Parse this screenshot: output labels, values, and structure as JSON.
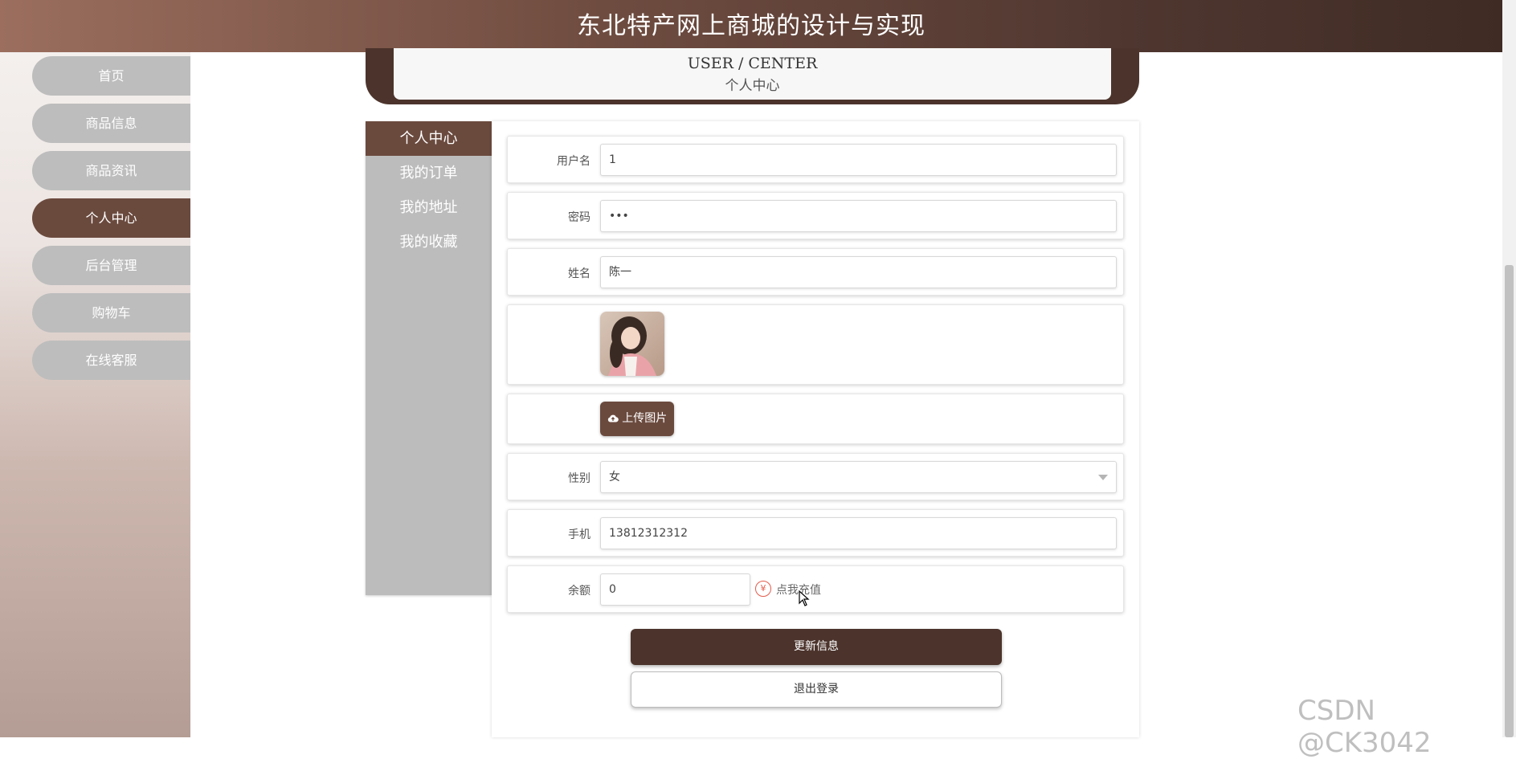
{
  "header": {
    "title": "东北特产网上商城的设计与实现"
  },
  "sidebar": {
    "items": [
      {
        "label": "首页",
        "active": false
      },
      {
        "label": "商品信息",
        "active": false
      },
      {
        "label": "商品资讯",
        "active": false
      },
      {
        "label": "个人中心",
        "active": true
      },
      {
        "label": "后台管理",
        "active": false
      },
      {
        "label": "购物车",
        "active": false
      },
      {
        "label": "在线客服",
        "active": false
      }
    ]
  },
  "banner": {
    "title_en": "USER / CENTER",
    "title_cn": "个人中心"
  },
  "tabs": [
    {
      "label": "个人中心",
      "active": true
    },
    {
      "label": "我的订单",
      "active": false
    },
    {
      "label": "我的地址",
      "active": false
    },
    {
      "label": "我的收藏",
      "active": false
    }
  ],
  "form": {
    "username": {
      "label": "用户名",
      "value": "1"
    },
    "password": {
      "label": "密码",
      "value": "•••"
    },
    "name": {
      "label": "姓名",
      "value": "陈一"
    },
    "upload": {
      "label": "上传图片",
      "icon": "cloud-upload-icon"
    },
    "gender": {
      "label": "性别",
      "value": "女"
    },
    "phone": {
      "label": "手机",
      "value": "13812312312"
    },
    "balance": {
      "label": "余额",
      "value": "0",
      "recharge_label": "点我充值",
      "currency_icon": "yen-icon"
    }
  },
  "actions": {
    "update_label": "更新信息",
    "logout_label": "退出登录"
  },
  "watermark": "CSDN @CK3042",
  "colors": {
    "brand": "#6b4a3e",
    "dark": "#4c342c",
    "inactive": "#bdbdbd",
    "accent": "#e25c4d"
  }
}
